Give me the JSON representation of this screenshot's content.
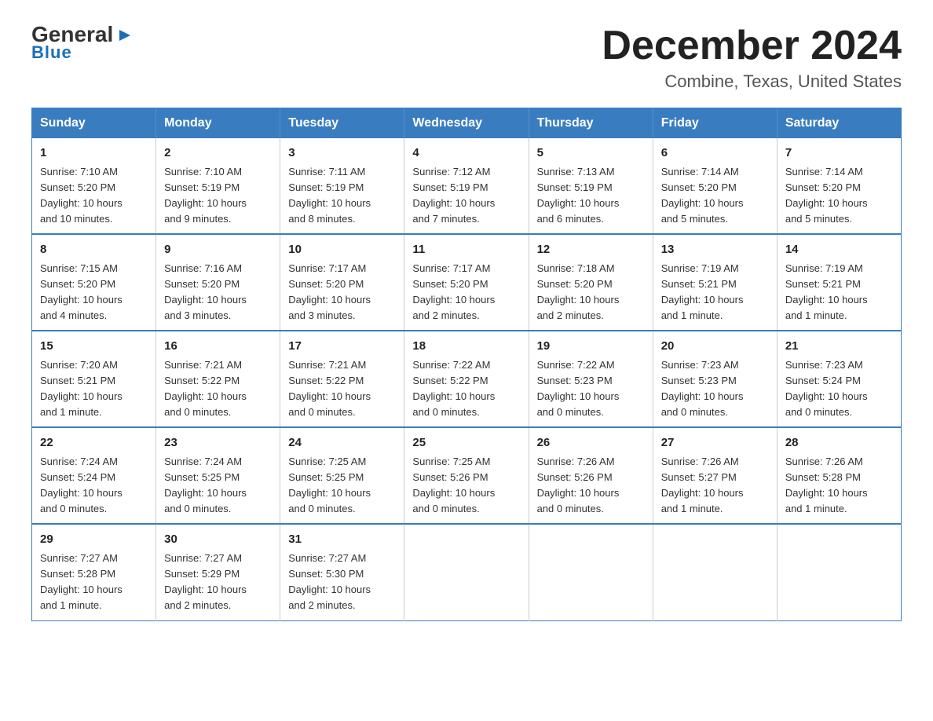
{
  "logo": {
    "general": "General",
    "blue": "Blue"
  },
  "title": "December 2024",
  "subtitle": "Combine, Texas, United States",
  "days_of_week": [
    "Sunday",
    "Monday",
    "Tuesday",
    "Wednesday",
    "Thursday",
    "Friday",
    "Saturday"
  ],
  "weeks": [
    [
      {
        "day": "1",
        "info": "Sunrise: 7:10 AM\nSunset: 5:20 PM\nDaylight: 10 hours\nand 10 minutes."
      },
      {
        "day": "2",
        "info": "Sunrise: 7:10 AM\nSunset: 5:19 PM\nDaylight: 10 hours\nand 9 minutes."
      },
      {
        "day": "3",
        "info": "Sunrise: 7:11 AM\nSunset: 5:19 PM\nDaylight: 10 hours\nand 8 minutes."
      },
      {
        "day": "4",
        "info": "Sunrise: 7:12 AM\nSunset: 5:19 PM\nDaylight: 10 hours\nand 7 minutes."
      },
      {
        "day": "5",
        "info": "Sunrise: 7:13 AM\nSunset: 5:19 PM\nDaylight: 10 hours\nand 6 minutes."
      },
      {
        "day": "6",
        "info": "Sunrise: 7:14 AM\nSunset: 5:20 PM\nDaylight: 10 hours\nand 5 minutes."
      },
      {
        "day": "7",
        "info": "Sunrise: 7:14 AM\nSunset: 5:20 PM\nDaylight: 10 hours\nand 5 minutes."
      }
    ],
    [
      {
        "day": "8",
        "info": "Sunrise: 7:15 AM\nSunset: 5:20 PM\nDaylight: 10 hours\nand 4 minutes."
      },
      {
        "day": "9",
        "info": "Sunrise: 7:16 AM\nSunset: 5:20 PM\nDaylight: 10 hours\nand 3 minutes."
      },
      {
        "day": "10",
        "info": "Sunrise: 7:17 AM\nSunset: 5:20 PM\nDaylight: 10 hours\nand 3 minutes."
      },
      {
        "day": "11",
        "info": "Sunrise: 7:17 AM\nSunset: 5:20 PM\nDaylight: 10 hours\nand 2 minutes."
      },
      {
        "day": "12",
        "info": "Sunrise: 7:18 AM\nSunset: 5:20 PM\nDaylight: 10 hours\nand 2 minutes."
      },
      {
        "day": "13",
        "info": "Sunrise: 7:19 AM\nSunset: 5:21 PM\nDaylight: 10 hours\nand 1 minute."
      },
      {
        "day": "14",
        "info": "Sunrise: 7:19 AM\nSunset: 5:21 PM\nDaylight: 10 hours\nand 1 minute."
      }
    ],
    [
      {
        "day": "15",
        "info": "Sunrise: 7:20 AM\nSunset: 5:21 PM\nDaylight: 10 hours\nand 1 minute."
      },
      {
        "day": "16",
        "info": "Sunrise: 7:21 AM\nSunset: 5:22 PM\nDaylight: 10 hours\nand 0 minutes."
      },
      {
        "day": "17",
        "info": "Sunrise: 7:21 AM\nSunset: 5:22 PM\nDaylight: 10 hours\nand 0 minutes."
      },
      {
        "day": "18",
        "info": "Sunrise: 7:22 AM\nSunset: 5:22 PM\nDaylight: 10 hours\nand 0 minutes."
      },
      {
        "day": "19",
        "info": "Sunrise: 7:22 AM\nSunset: 5:23 PM\nDaylight: 10 hours\nand 0 minutes."
      },
      {
        "day": "20",
        "info": "Sunrise: 7:23 AM\nSunset: 5:23 PM\nDaylight: 10 hours\nand 0 minutes."
      },
      {
        "day": "21",
        "info": "Sunrise: 7:23 AM\nSunset: 5:24 PM\nDaylight: 10 hours\nand 0 minutes."
      }
    ],
    [
      {
        "day": "22",
        "info": "Sunrise: 7:24 AM\nSunset: 5:24 PM\nDaylight: 10 hours\nand 0 minutes."
      },
      {
        "day": "23",
        "info": "Sunrise: 7:24 AM\nSunset: 5:25 PM\nDaylight: 10 hours\nand 0 minutes."
      },
      {
        "day": "24",
        "info": "Sunrise: 7:25 AM\nSunset: 5:25 PM\nDaylight: 10 hours\nand 0 minutes."
      },
      {
        "day": "25",
        "info": "Sunrise: 7:25 AM\nSunset: 5:26 PM\nDaylight: 10 hours\nand 0 minutes."
      },
      {
        "day": "26",
        "info": "Sunrise: 7:26 AM\nSunset: 5:26 PM\nDaylight: 10 hours\nand 0 minutes."
      },
      {
        "day": "27",
        "info": "Sunrise: 7:26 AM\nSunset: 5:27 PM\nDaylight: 10 hours\nand 1 minute."
      },
      {
        "day": "28",
        "info": "Sunrise: 7:26 AM\nSunset: 5:28 PM\nDaylight: 10 hours\nand 1 minute."
      }
    ],
    [
      {
        "day": "29",
        "info": "Sunrise: 7:27 AM\nSunset: 5:28 PM\nDaylight: 10 hours\nand 1 minute."
      },
      {
        "day": "30",
        "info": "Sunrise: 7:27 AM\nSunset: 5:29 PM\nDaylight: 10 hours\nand 2 minutes."
      },
      {
        "day": "31",
        "info": "Sunrise: 7:27 AM\nSunset: 5:30 PM\nDaylight: 10 hours\nand 2 minutes."
      },
      {
        "day": "",
        "info": ""
      },
      {
        "day": "",
        "info": ""
      },
      {
        "day": "",
        "info": ""
      },
      {
        "day": "",
        "info": ""
      }
    ]
  ]
}
